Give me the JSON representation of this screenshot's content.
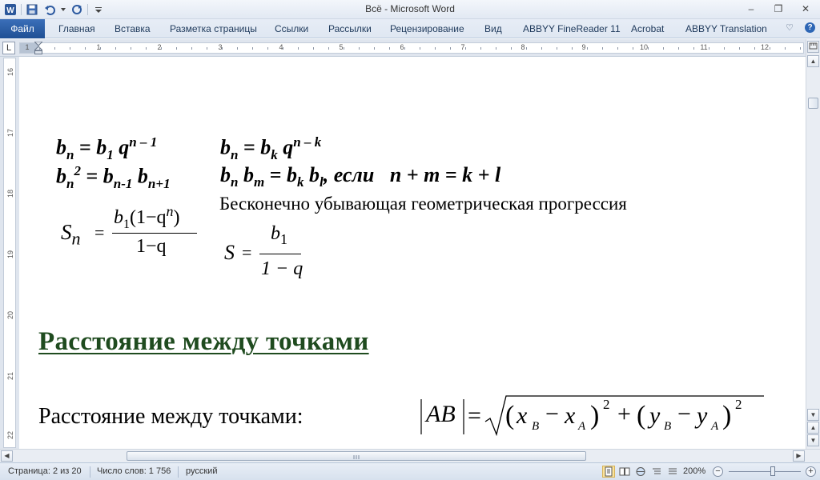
{
  "window": {
    "title": "Всё  -  Microsoft Word",
    "controls": {
      "minimize": "‒",
      "restore": "❐",
      "close": "✕"
    }
  },
  "quick_access": {
    "app_icon": "W",
    "save_icon": "save-icon",
    "undo_icon": "undo-icon",
    "redo_icon": "redo-icon"
  },
  "ribbon": {
    "tabs": [
      "Файл",
      "Главная",
      "Вставка",
      "Разметка страницы",
      "Ссылки",
      "Рассылки",
      "Рецензирование",
      "Вид",
      "ABBYY FineReader 11",
      "Acrobat",
      "ABBYY Translation"
    ],
    "help": "?",
    "collapse": "♡"
  },
  "rulers": {
    "corner": "L",
    "horizontal_numbers": [
      "1",
      "1",
      "2",
      "3",
      "4",
      "5",
      "6",
      "7",
      "8",
      "9",
      "10",
      "11",
      "12"
    ],
    "vertical_numbers": [
      "16",
      "17",
      "18",
      "19",
      "20",
      "21",
      "22"
    ]
  },
  "document": {
    "formulas": {
      "line1_left": {
        "b": "b",
        "n": "n",
        "eq": " = ",
        "b1": "b",
        "one": "1",
        "q": " q",
        "exp": "n – 1"
      },
      "line1_right": {
        "b": "b",
        "n": "n",
        "eq": " = ",
        "bk": "b",
        "k": "k",
        "q": " q",
        "exp": "n – k"
      },
      "line2_left": {
        "b": "b",
        "n": "n",
        "sq": "2",
        "eq": " = ",
        "b2": "b",
        "nm1": "n-1",
        "b3": " b",
        "np1": "n+1"
      },
      "line2_right": {
        "b": "b",
        "n": "n",
        "b2": " b",
        "m": "m",
        "eq": " = ",
        "bk": "b",
        "k": "k",
        "b3": " b",
        "l": "l",
        "comma": ",  ",
        "esli": "если",
        "cond": "n + m = k + l"
      }
    },
    "progression_heading": "Бесконечно убывающая геометрическая прогрессия",
    "sum_formula": {
      "lhs": "S",
      "sub": "n",
      "eq": "=",
      "num": "b",
      "num_sub": "1",
      "num_rest": "(1−q",
      "num_exp": "n",
      "num_close": ")",
      "den": "1−q"
    },
    "infinite_formula": {
      "lhs": "S",
      "eq": "=",
      "num": "b",
      "num_sub": "1",
      "den": "1 − q"
    },
    "section_heading": "Расстояние между точками",
    "distance_label": "Расстояние между точками:",
    "distance_formula": {
      "ab": "AB",
      "eq": "=",
      "open1": "(",
      "x": "x",
      "xb": "B",
      "minus": "−",
      "x2": "x",
      "xa": "A",
      "close1": ")",
      "sq1": "2",
      "plus": "+",
      "open2": "(",
      "y": "y",
      "yb": "B",
      "y2": "y",
      "ya": "A",
      "close2": ")",
      "sq2": "2"
    }
  },
  "statusbar": {
    "page": "Страница: 2 из 20",
    "words": "Число слов: 1 756",
    "language": "русский",
    "zoom": "200%",
    "zoom_minus": "−",
    "zoom_plus": "+"
  }
}
